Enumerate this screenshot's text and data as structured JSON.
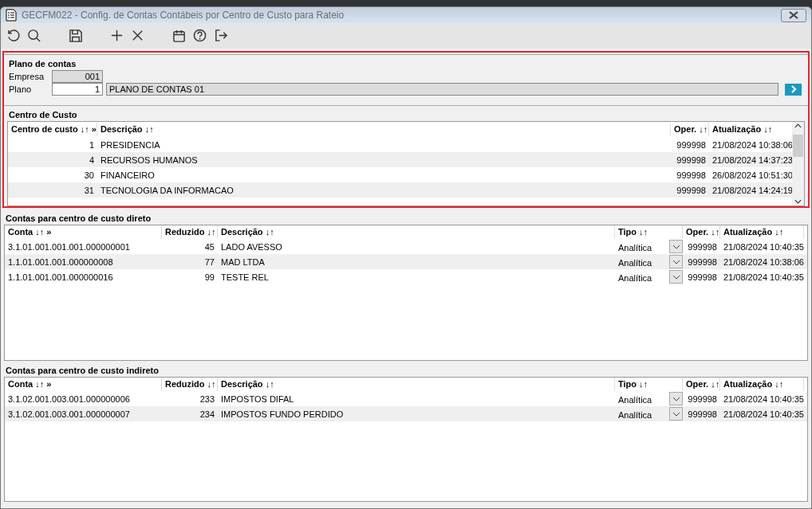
{
  "window": {
    "title": "GECFM022 - Config. de Contas Contábeis por Centro de Custo para Rateio"
  },
  "toolbar": [
    {
      "kind": "undo"
    },
    {
      "kind": "search"
    },
    {
      "kind": "gap"
    },
    {
      "kind": "save"
    },
    {
      "kind": "gap"
    },
    {
      "kind": "add"
    },
    {
      "kind": "delete"
    },
    {
      "kind": "gap"
    },
    {
      "kind": "calendar"
    },
    {
      "kind": "help"
    },
    {
      "kind": "exit"
    }
  ],
  "plano_de_contas": {
    "title": "Plano de contas",
    "empresa_label": "Empresa",
    "empresa_value": "001",
    "plano_label": "Plano",
    "plano_value": "1",
    "plano_description": "PLANO DE CONTAS 01"
  },
  "centro_de_custo": {
    "title": "Centro de Custo",
    "columns": [
      "Centro de custo ↓↑ »",
      "Descrição ↓↑",
      "Oper. ↓↑",
      "Atualização ↓↑"
    ],
    "rows": [
      [
        "1",
        "PRESIDENCIA",
        "999998",
        "21/08/2024 10:38:06"
      ],
      [
        "4",
        "RECURSOS HUMANOS",
        "999998",
        "21/08/2024 14:37:23"
      ],
      [
        "30",
        "FINANCEIRO",
        "999998",
        "26/08/2024 10:51:30"
      ],
      [
        "31",
        "TECNOLOGIA DA INFORMACAO",
        "999998",
        "21/08/2024 14:24:19"
      ]
    ]
  },
  "contas_direto": {
    "title": "Contas para centro de custo direto",
    "columns": [
      "Conta ↓↑ »",
      "Reduzido ↓↑",
      "Descrição ↓↑",
      "Tipo ↓↑",
      "Oper. ↓↑",
      "Atualização ↓↑"
    ],
    "rows": [
      [
        "3.1.01.001.001.001.000000001",
        "45",
        "LADO AVESSO",
        "Analítica",
        "999998",
        "21/08/2024 10:40:35"
      ],
      [
        "1.1.01.001.001.000000008",
        "77",
        "MAD LTDA",
        "Analítica",
        "999998",
        "21/08/2024 10:38:06"
      ],
      [
        "1.1.01.001.001.000000016",
        "99",
        "TESTE REL",
        "Analítica",
        "999998",
        "21/08/2024 10:40:35"
      ]
    ]
  },
  "contas_indireto": {
    "title": "Contas para centro de custo indireto",
    "columns": [
      "Conta ↓↑ »",
      "Reduzido ↓↑",
      "Descrição ↓↑",
      "Tipo ↓↑",
      "Oper. ↓↑",
      "Atualização ↓↑"
    ],
    "rows": [
      [
        "3.1.02.001.003.001.000000006",
        "233",
        "IMPOSTOS DIFAL",
        "Analítica",
        "999998",
        "21/08/2024 10:40:35"
      ],
      [
        "3.1.02.001.003.001.000000007",
        "234",
        "IMPOSTOS FUNDO PERDIDO",
        "Analítica",
        "999998",
        "21/08/2024 10:40:35"
      ]
    ]
  }
}
